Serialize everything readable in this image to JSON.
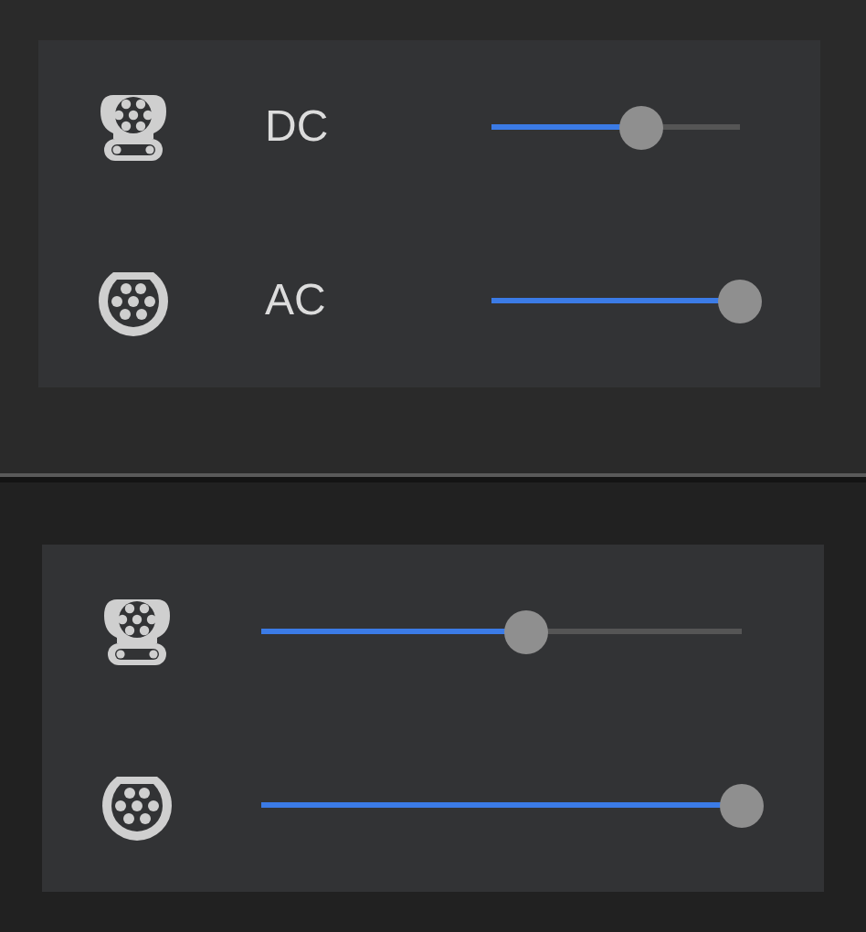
{
  "panels": [
    {
      "rows": [
        {
          "kind": "dc",
          "label": "DC",
          "level": 0.6
        },
        {
          "kind": "ac",
          "label": "AC",
          "level": 1.0
        }
      ]
    },
    {
      "rows": [
        {
          "kind": "dc",
          "level": 0.55
        },
        {
          "kind": "ac",
          "level": 1.0
        }
      ]
    }
  ]
}
